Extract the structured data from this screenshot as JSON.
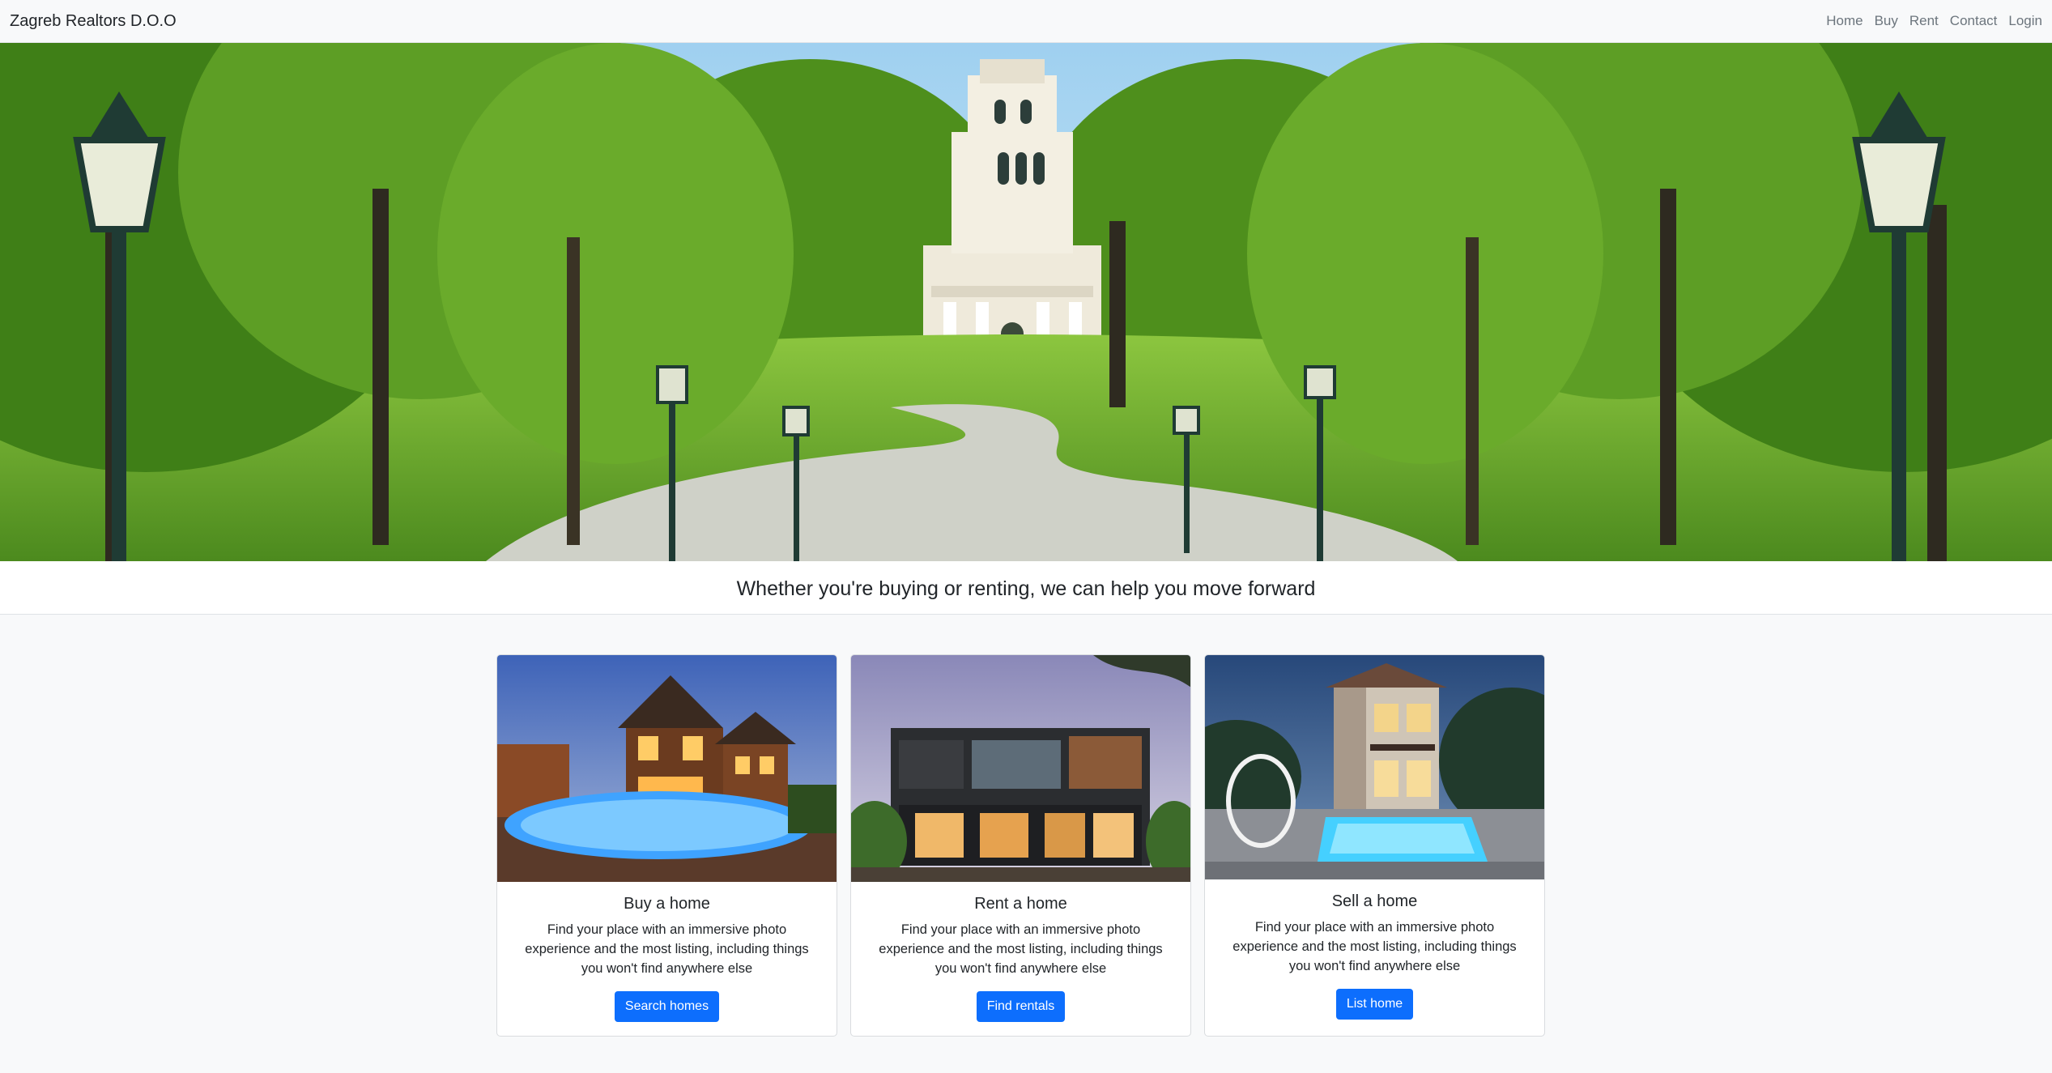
{
  "navbar": {
    "brand": "Zagreb Realtors D.O.O",
    "links": [
      "Home",
      "Buy",
      "Rent",
      "Contact",
      "Login"
    ]
  },
  "hero": {
    "image": "park-tower-pathway-with-lampposts"
  },
  "tagline": "Whether you're buying or renting, we can help you move forward",
  "cards": [
    {
      "image": "wooden-house-with-pool-at-dusk",
      "title": "Buy a home",
      "text": "Find your place with an immersive photo experience and the most listing, including things you won't find anywhere else",
      "button": "Search homes"
    },
    {
      "image": "modern-dark-two-story-house",
      "title": "Rent a home",
      "text": "Find your place with an immersive photo experience and the most listing, including things you won't find anywhere else",
      "button": "Find rentals"
    },
    {
      "image": "stone-villa-with-pool-at-dusk",
      "title": "Sell a home",
      "text": "Find your place with an immersive photo experience and the most listing, including things you won't find anywhere else",
      "button": "List home"
    }
  ],
  "colors": {
    "primary": "#0d6efd",
    "navbar_bg": "#f8f9fa",
    "nav_link": "#6c757d"
  }
}
